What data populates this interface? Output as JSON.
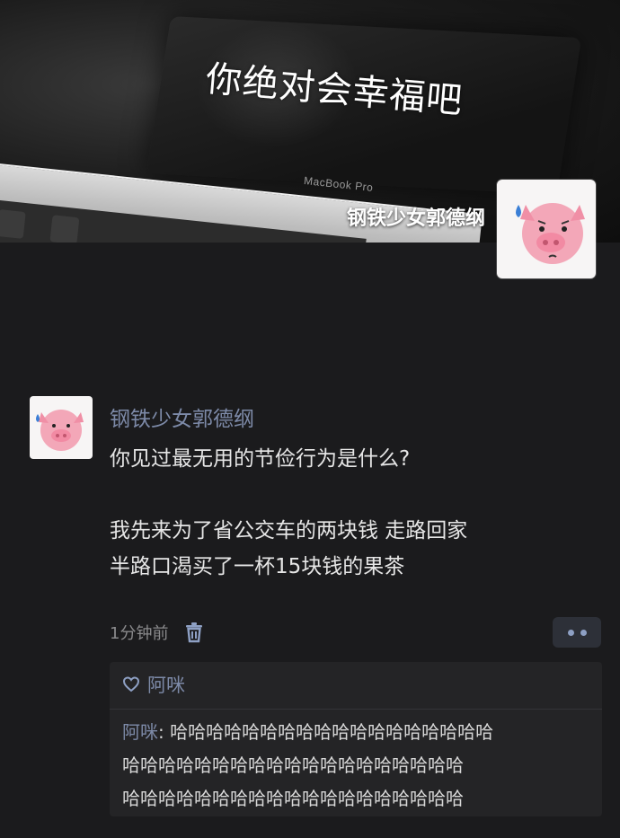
{
  "header": {
    "cover_caption": "你绝对会幸福吧",
    "cover_brand_text": "MacBook Pro",
    "profile_name": "钢铁少女郭德纲",
    "avatar_icon": "pig-avatar-icon"
  },
  "post": {
    "author": "钢铁少女郭德纲",
    "lines": [
      "你见过最无用的节俭行为是什么?",
      "",
      "我先来为了省公交车的两块钱 走路回家",
      "半路口渴买了一杯15块钱的果茶"
    ],
    "time": "1分钟前",
    "delete_icon": "trash-icon",
    "more_icon": "more-dots-icon"
  },
  "interactions": {
    "like_icon": "heart-icon",
    "likes": "阿咪",
    "comment": {
      "author": "阿咪",
      "separator": ": ",
      "line1": "哈哈哈哈哈哈哈哈哈哈哈哈哈哈哈哈哈哈",
      "line2": "哈哈哈哈哈哈哈哈哈哈哈哈哈哈哈哈哈哈哈",
      "line3": "哈哈哈哈哈哈哈哈哈哈哈哈哈哈哈哈哈哈哈"
    }
  },
  "colors": {
    "background": "#1b1b1d",
    "name_link": "#7d8aa8",
    "body_text": "#e6e6e6",
    "meta_text": "#8a8a8c",
    "panel": "#242426"
  }
}
